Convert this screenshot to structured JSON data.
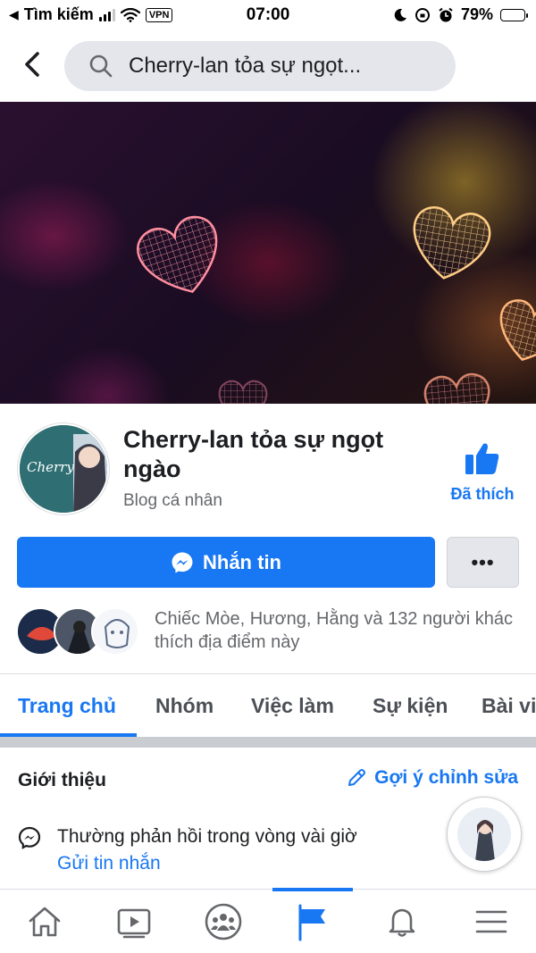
{
  "status_bar": {
    "back_app": "Tìm kiếm",
    "vpn": "VPN",
    "time": "07:00",
    "battery": "79%",
    "battery_level": 0.79
  },
  "search": {
    "query": "Cherry-lan tỏa sự ngọt..."
  },
  "page": {
    "name": "Cherry-lan tỏa sự ngọt ngào",
    "category": "Blog cá nhân",
    "like_label": "Đã thích",
    "avatar_text": "Cherry"
  },
  "actions": {
    "message_label": "Nhắn tin",
    "more_label": "•••"
  },
  "friends": {
    "text": "Chiếc Mòe, Hương, Hằng và 132 người khác thích địa điểm này"
  },
  "tabs": [
    {
      "label": "Trang chủ",
      "active": true
    },
    {
      "label": "Nhóm"
    },
    {
      "label": "Việc làm"
    },
    {
      "label": "Sự kiện"
    },
    {
      "label": "Bài vi"
    }
  ],
  "about": {
    "title": "Giới thiệu",
    "edit_label": "Gợi ý chỉnh sửa",
    "response_text": "Thường phản hồi trong vòng vài giờ",
    "send_message_link": "Gửi tin nhắn"
  },
  "bottom_nav": [
    {
      "icon": "home-icon"
    },
    {
      "icon": "video-icon"
    },
    {
      "icon": "groups-icon"
    },
    {
      "icon": "pages-flag-icon",
      "active": true
    },
    {
      "icon": "bell-icon"
    },
    {
      "icon": "menu-icon"
    }
  ],
  "colors": {
    "brand_blue": "#1877f2",
    "secondary_text": "#65676b",
    "button_gray": "#e4e6eb"
  }
}
